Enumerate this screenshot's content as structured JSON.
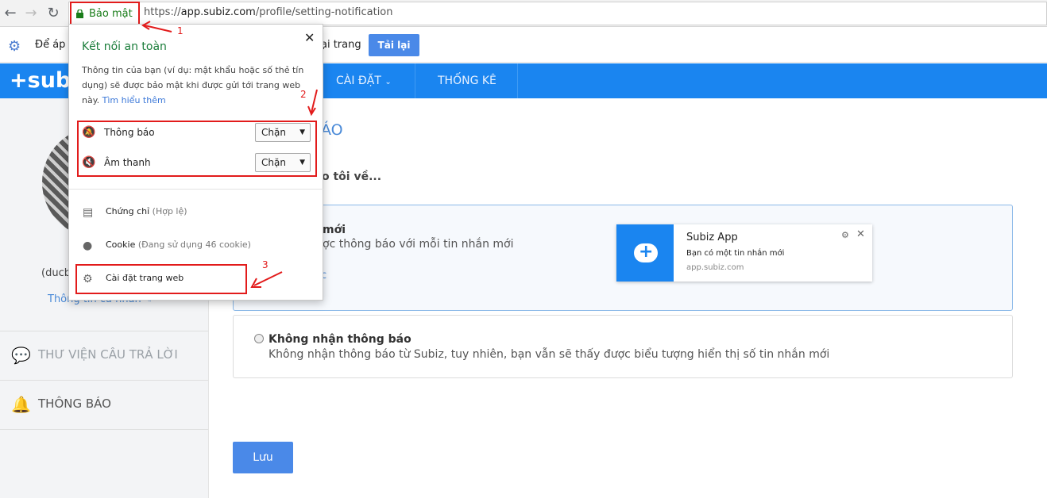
{
  "browser": {
    "secure_label": "Bảo mật",
    "url_scheme": "https://",
    "url_host": "app.subiz.com",
    "url_path": "/profile/setting-notification"
  },
  "infobar": {
    "message_start": "Để áp d",
    "message_end": "ại trang",
    "reload_label": "Tải lại"
  },
  "app_nav": {
    "logo": "+sub",
    "items": [
      "CÀI ĐẶT",
      "THỐNG KÊ"
    ]
  },
  "sidebar": {
    "username": "(ducb",
    "profile_link": "Thông tin cá nhân",
    "items": [
      {
        "label": "THƯ VIỆN CÂU TRẢ LỜI",
        "icon": "chat-bubble-icon"
      },
      {
        "label": "THÔNG BÁO",
        "icon": "bell-icon"
      }
    ]
  },
  "main": {
    "heading_partial": "ÁO",
    "question_partial": "o tôi về...",
    "option1": {
      "title_partial": "mới",
      "desc_partial": "ợc thông báo với mỗi tin nhắn mới",
      "link_partial": "c"
    },
    "notification_preview": {
      "app_name": "Subiz App",
      "message": "Bạn có một tin nhắn mới",
      "host": "app.subiz.com"
    },
    "option2": {
      "title": "Không nhận thông báo",
      "desc": "Không nhận thông báo từ Subiz, tuy nhiên, bạn vẫn sẽ thấy được biểu tượng hiển thị số tin nhắn mới"
    },
    "save_label": "Lưu"
  },
  "popup": {
    "title": "Kết nối an toàn",
    "desc": "Thông tin của bạn (ví dụ: mật khẩu hoặc số thẻ tín dụng) sẽ được bảo mật khi được gửi tới trang web này.",
    "learn_more": "Tìm hiểu thêm",
    "permissions": [
      {
        "label": "Thông báo",
        "value": "Chặn",
        "icon": "bell-blocked-icon"
      },
      {
        "label": "Âm thanh",
        "value": "Chặn",
        "icon": "speaker-blocked-icon"
      }
    ],
    "info_rows": [
      {
        "label": "Chứng chỉ",
        "sub": "(Hợp lệ)",
        "icon": "certificate-icon"
      },
      {
        "label": "Cookie",
        "sub": "(Đang sử dụng 46 cookie)",
        "icon": "cookie-icon"
      },
      {
        "label": "Cài đặt trang web",
        "sub": "",
        "icon": "gear-icon"
      }
    ]
  },
  "annotations": [
    "1",
    "2",
    "3"
  ],
  "colors": {
    "accent": "#1a85f0",
    "annotation": "#e21b1b",
    "secure": "#1a7d1a"
  }
}
